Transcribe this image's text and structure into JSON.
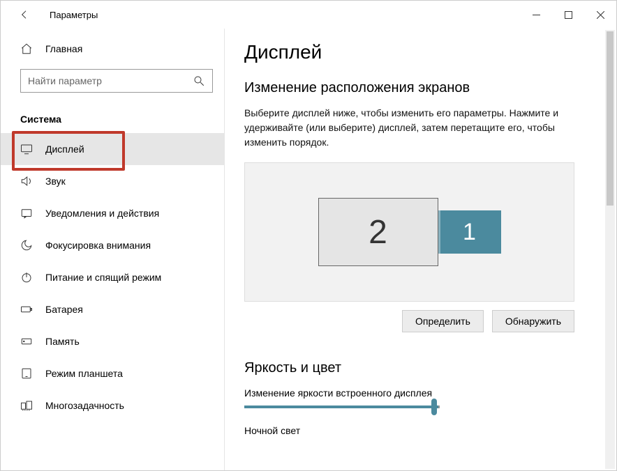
{
  "window": {
    "title": "Параметры"
  },
  "sidebar": {
    "home": "Главная",
    "search_placeholder": "Найти параметр",
    "section": "Система",
    "items": [
      {
        "label": "Дисплей"
      },
      {
        "label": "Звук"
      },
      {
        "label": "Уведомления и действия"
      },
      {
        "label": "Фокусировка внимания"
      },
      {
        "label": "Питание и спящий режим"
      },
      {
        "label": "Батарея"
      },
      {
        "label": "Память"
      },
      {
        "label": "Режим планшета"
      },
      {
        "label": "Многозадачность"
      }
    ]
  },
  "main": {
    "title": "Дисплей",
    "arrange_title": "Изменение расположения экранов",
    "arrange_desc": "Выберите дисплей ниже, чтобы изменить его параметры. Нажмите и удерживайте (или выберите) дисплей, затем перетащите его, чтобы изменить порядок.",
    "monitors": {
      "secondary": "2",
      "primary": "1"
    },
    "btn_identify": "Определить",
    "btn_detect": "Обнаружить",
    "brightness_title": "Яркость и цвет",
    "brightness_label": "Изменение яркости встроенного дисплея",
    "brightness_value": 96,
    "night_light_label": "Ночной свет"
  }
}
